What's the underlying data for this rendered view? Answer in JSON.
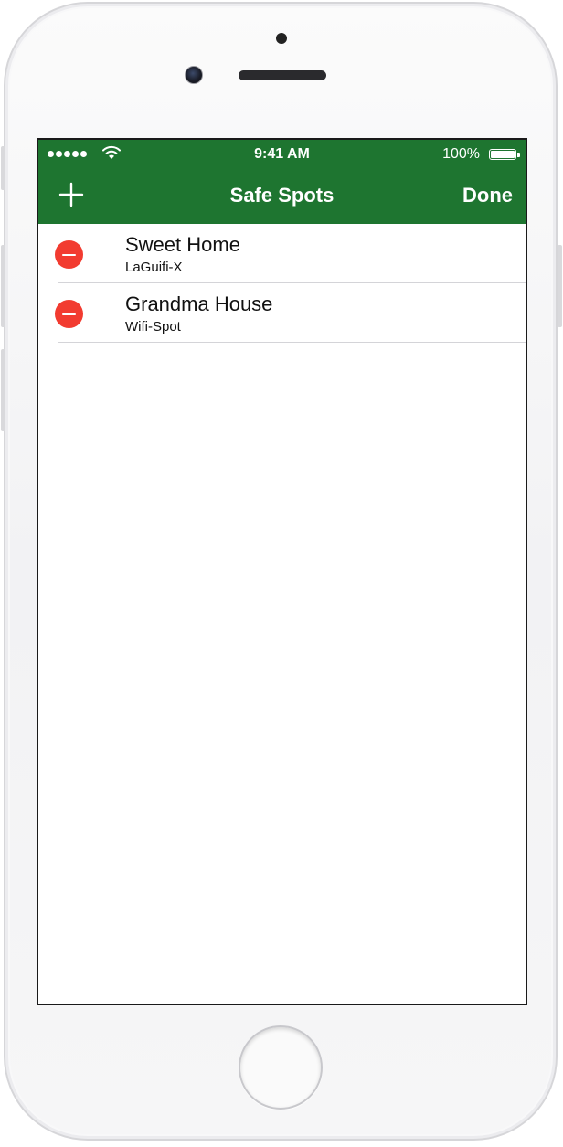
{
  "status_bar": {
    "time": "9:41 AM",
    "battery": "100%",
    "battery_level": 1.0,
    "signal_icon": "signal-dots-icon",
    "wifi_icon": "wifi-icon"
  },
  "navbar": {
    "title": "Safe Spots",
    "done_label": "Done",
    "add_icon": "plus-icon",
    "background_color": "#1e7530"
  },
  "spots": [
    {
      "name": "Sweet Home",
      "network": "LaGuifi-X"
    },
    {
      "name": "Grandma House",
      "network": "Wifi-Spot"
    }
  ],
  "colors": {
    "delete": "#f23b30"
  }
}
